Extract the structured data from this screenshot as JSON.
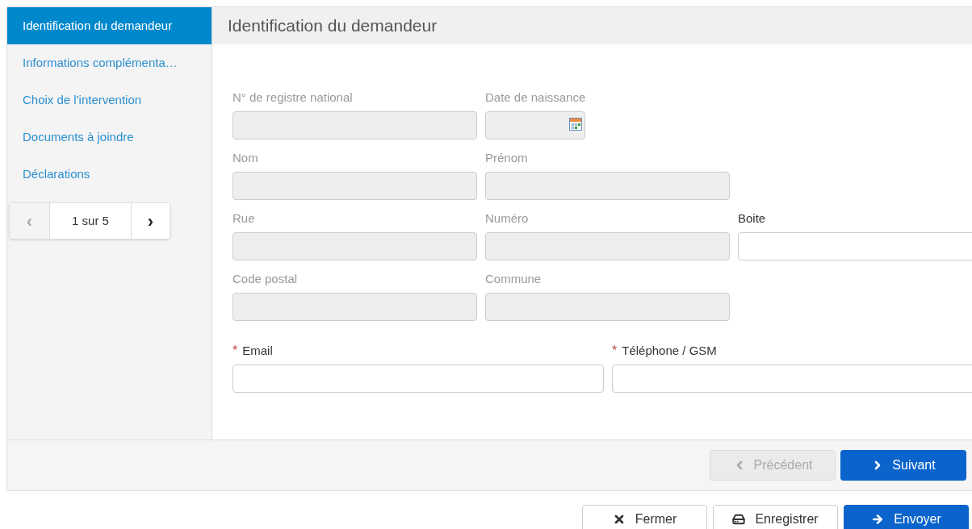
{
  "steps": [
    {
      "label": "Identification du demandeur",
      "selected": true
    },
    {
      "label": "Informations complémenta…",
      "selected": false
    },
    {
      "label": "Choix de l'intervention",
      "selected": false
    },
    {
      "label": "Documents à joindre",
      "selected": false
    },
    {
      "label": "Déclarations",
      "selected": false
    }
  ],
  "pager": {
    "prev": "‹",
    "text": "1 sur 5",
    "next": "›",
    "prev_disabled": true
  },
  "section_title": "Identification du demandeur",
  "rows": [
    [
      {
        "label": "N° de registre national",
        "kind": "text",
        "disabled": true,
        "required": false
      },
      {
        "label": "Date de naissance",
        "kind": "date",
        "disabled": true,
        "required": false
      }
    ],
    [
      {
        "label": "Nom",
        "kind": "text",
        "disabled": true,
        "required": false
      },
      {
        "label": "Prénom",
        "kind": "text",
        "disabled": true,
        "required": false
      }
    ],
    [
      {
        "label": "Rue",
        "kind": "text",
        "disabled": true,
        "required": false
      },
      {
        "label": "Numéro",
        "kind": "text",
        "disabled": true,
        "required": false
      },
      {
        "label": "Boite",
        "kind": "text",
        "disabled": false,
        "required": false
      }
    ],
    [
      {
        "label": "Code postal",
        "kind": "text",
        "disabled": true,
        "required": false
      },
      {
        "label": "Commune",
        "kind": "text",
        "disabled": true,
        "required": false
      }
    ],
    [
      {
        "label": "Email",
        "kind": "contact",
        "disabled": false,
        "required": true,
        "marker": "*"
      },
      {
        "label": "Téléphone / GSM",
        "kind": "contact",
        "disabled": false,
        "required": true,
        "marker": "*"
      }
    ]
  ],
  "nav_buttons": [
    {
      "label": "Précédent",
      "kind": "prev",
      "disabled": true
    },
    {
      "label": "Suivant",
      "kind": "next",
      "disabled": false
    }
  ],
  "actions": [
    {
      "label": "Fermer",
      "kind": "close",
      "primary": false
    },
    {
      "label": "Enregistrer",
      "kind": "save",
      "primary": false
    },
    {
      "label": "Envoyer",
      "kind": "send",
      "primary": true
    }
  ]
}
